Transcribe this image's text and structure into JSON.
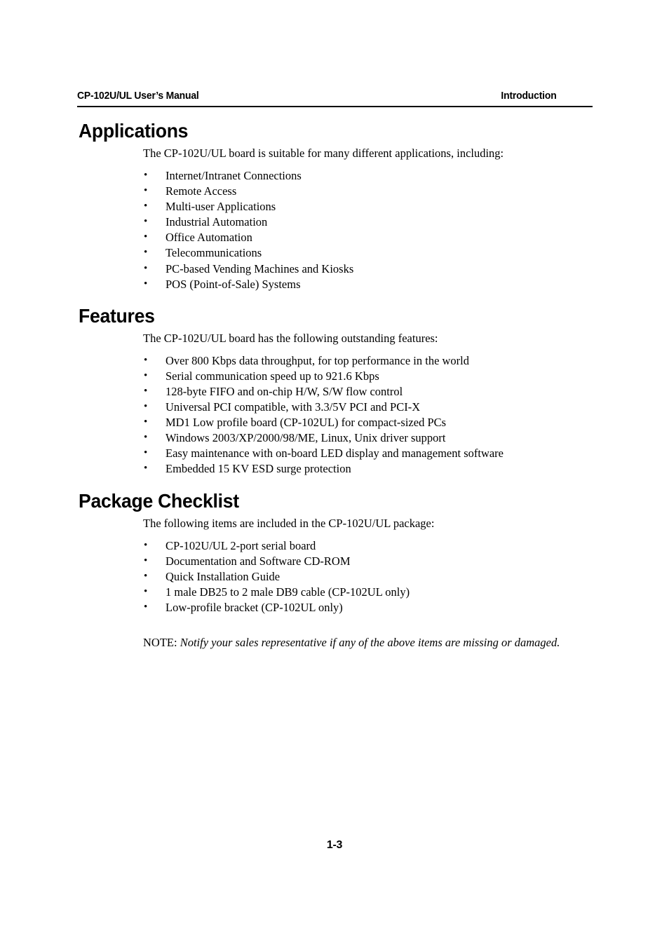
{
  "header": {
    "left_title": "CP-102U/UL User’s Manual",
    "right_title": "Introduction"
  },
  "sections": [
    {
      "id": "applications",
      "title": "Applications",
      "lead": "The CP-102U/UL board is suitable for many different applications, including:",
      "bullets": [
        "Internet/Intranet Connections",
        "Remote Access",
        "Multi-user Applications",
        "Industrial Automation",
        "Office Automation",
        "Telecommunications",
        "PC-based Vending Machines and Kiosks",
        "POS (Point-of-Sale) Systems"
      ]
    },
    {
      "id": "features",
      "title": "Features",
      "lead": "The CP-102U/UL board has the following outstanding features:",
      "bullets": [
        "Over 800 Kbps data throughput, for top performance in the world",
        "Serial communication speed up to 921.6 Kbps",
        "128-byte FIFO and on-chip H/W, S/W flow control",
        "Universal PCI compatible, with 3.3/5V PCI and PCI-X",
        "MD1 Low profile board (CP-102UL) for compact-sized PCs",
        "Windows 2003/XP/2000/98/ME, Linux, Unix driver support",
        "Easy maintenance with on-board LED display and management software",
        "Embedded 15 KV ESD surge protection"
      ]
    },
    {
      "id": "package-checklist",
      "title": "Package Checklist",
      "lead": "The following items are included in the CP-102U/UL package:",
      "bullets": [
        "CP-102U/UL 2-port serial board",
        "Documentation and Software CD-ROM",
        "Quick Installation Guide",
        "1 male DB25 to 2 male DB9 cable (CP-102UL only)",
        "Low-profile bracket (CP-102UL only)"
      ],
      "note_label": "NOTE: ",
      "note_body": "Notify your sales representative if any of the above items are missing or damaged."
    }
  ],
  "footer": {
    "page_number": "1-3"
  },
  "colors": {
    "page_background": "#ffffff",
    "text": "#000000",
    "rule": "#000000"
  }
}
